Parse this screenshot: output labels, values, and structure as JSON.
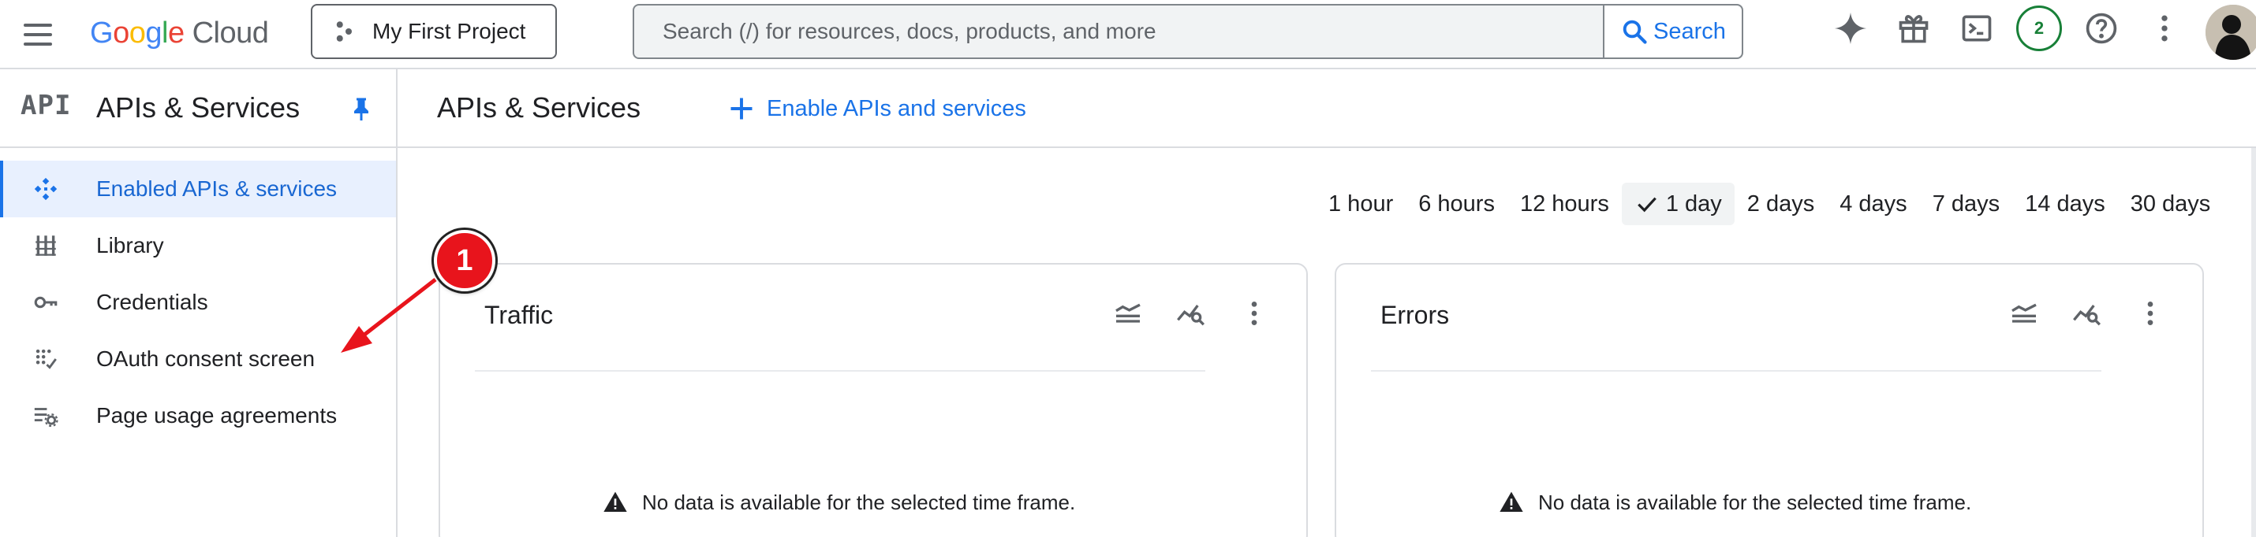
{
  "topbar": {
    "logo": {
      "G": "G",
      "o1": "o",
      "o2": "o",
      "g": "g",
      "l": "l",
      "e": "e",
      "cloud": "Cloud"
    },
    "project": "My First Project",
    "search_placeholder": "Search (/) for resources, docs, products, and more",
    "search_button": "Search",
    "notification_count": "2",
    "icons": [
      "gemini-icon",
      "gift-icon",
      "cloud-shell-icon",
      "notifications-badge",
      "help-icon",
      "more-vert-icon",
      "avatar"
    ]
  },
  "sidebar": {
    "api_logo": "API",
    "title": "APIs & Services",
    "items": [
      {
        "label": "Enabled APIs & services",
        "icon": "enabled-apis-icon",
        "active": true
      },
      {
        "label": "Library",
        "icon": "library-icon"
      },
      {
        "label": "Credentials",
        "icon": "key-icon"
      },
      {
        "label": "OAuth consent screen",
        "icon": "oauth-icon"
      },
      {
        "label": "Page usage agreements",
        "icon": "settings-list-icon"
      }
    ]
  },
  "main": {
    "title": "APIs & Services",
    "enable_button": "Enable APIs and services",
    "time_ranges": [
      "1 hour",
      "6 hours",
      "12 hours",
      "1 day",
      "2 days",
      "4 days",
      "7 days",
      "14 days",
      "30 days"
    ],
    "selected_range": "1 day",
    "cards": [
      {
        "title": "Traffic",
        "message": "No data is available for the selected time frame."
      },
      {
        "title": "Errors",
        "message": "No data is available for the selected time frame."
      }
    ]
  },
  "annotation": {
    "number": "1"
  },
  "colors": {
    "accent": "#1a73e8",
    "active_bg": "#e8f0fe",
    "annotation": "#e8141c",
    "badge": "#188038"
  }
}
